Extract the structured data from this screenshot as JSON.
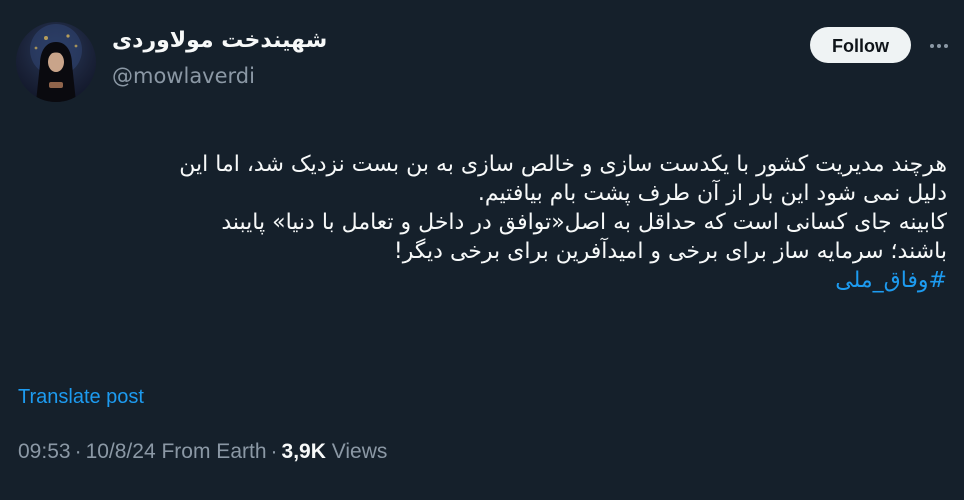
{
  "author": {
    "display_name": "شهیندخت مولاوردی",
    "handle": "@mowlaverdi"
  },
  "actions": {
    "follow_label": "Follow"
  },
  "icons": {
    "more": "more-horizontal-icon"
  },
  "post": {
    "lines": [
      "هرچند مدیریت کشور با یکدست سازی و خالص سازی به بن بست نزدیک شد، اما این",
      "دلیل نمی شود این بار از آن طرف پشت بام بیافتیم.",
      "کابینه جای کسانی است که حداقل به اصل«توافق در داخل و تعامل با دنیا» پایبند",
      "باشند؛ سرمایه ساز برای برخی و امیدآفرین برای برخی دیگر!"
    ],
    "hashtag": "#وفاق_ملی"
  },
  "translate_label": "Translate post",
  "meta": {
    "time": "09:53",
    "date": "10/8/24",
    "source": "From Earth",
    "separator": "·",
    "views_count": "3,9K",
    "views_label": "Views"
  },
  "colors": {
    "background": "#15202b",
    "link": "#1d9bf0",
    "muted": "#8b98a5",
    "text": "#f7f9f9"
  }
}
